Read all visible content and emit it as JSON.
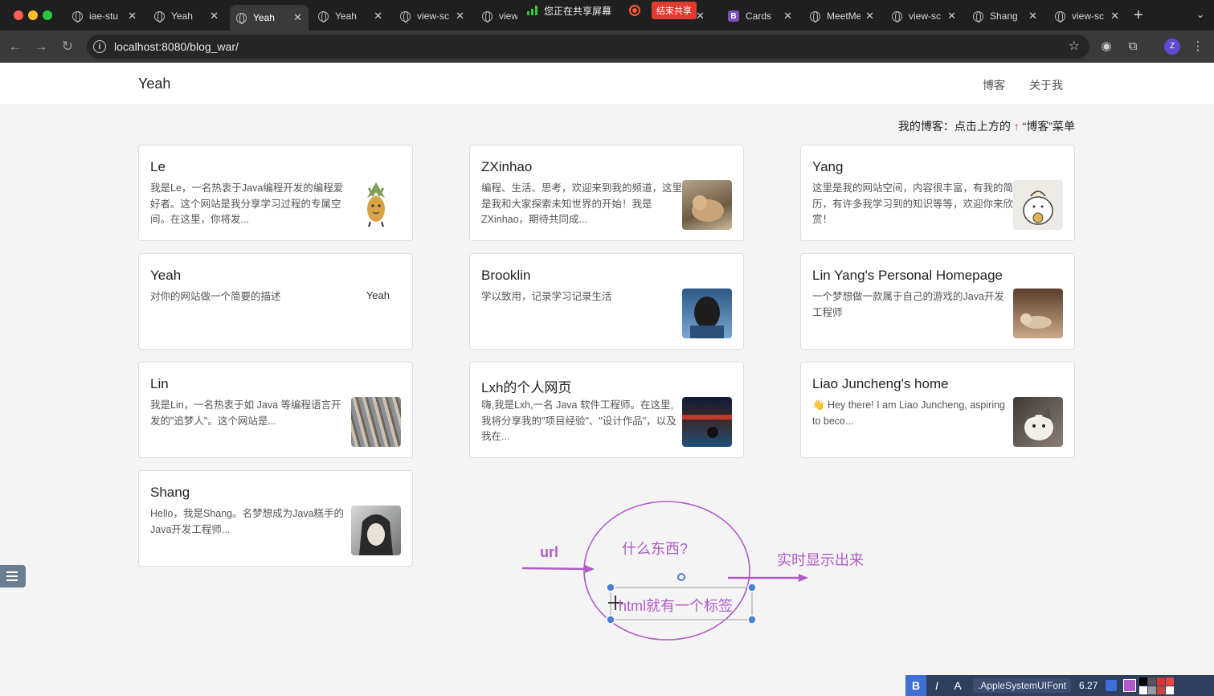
{
  "browser": {
    "tabs": [
      {
        "label": "iae-stu",
        "icon": "globe-icon",
        "active": false
      },
      {
        "label": "Yeah",
        "icon": "globe-icon",
        "active": false
      },
      {
        "label": "Yeah",
        "icon": "globe-icon",
        "active": true
      },
      {
        "label": "Yeah",
        "icon": "globe-icon",
        "active": false
      },
      {
        "label": "view-sc",
        "icon": "globe-icon",
        "active": false
      },
      {
        "label": "view-",
        "icon": "globe-icon",
        "active": false
      },
      {
        "label": "Cards",
        "icon": "bootstrap-icon",
        "active": false
      },
      {
        "label": "MeetMe",
        "icon": "globe-icon",
        "active": false
      },
      {
        "label": "view-sc",
        "icon": "globe-icon",
        "active": false
      },
      {
        "label": "Shang",
        "icon": "globe-icon",
        "active": false
      },
      {
        "label": "view-sc",
        "icon": "globe-icon",
        "active": false
      }
    ],
    "share_banner": {
      "text": "您正在共享屏幕",
      "stop_label": "结束共享"
    },
    "url": "localhost:8080/blog_war/",
    "profile_initial": "Z"
  },
  "site": {
    "brand": "Yeah",
    "nav": [
      {
        "label": "博客"
      },
      {
        "label": "关于我"
      }
    ],
    "hint": {
      "prefix": "我的博客：点击上方的",
      "arrow": "↑",
      "suffix": "“博客”菜单"
    }
  },
  "cards": [
    {
      "title": "Le",
      "desc": "我是Le，一名热衷于Java编程开发的编程爱好者。这个网站是我分享学习过程的专属空间。在这里，你将发...",
      "thumb": "pineapple-avatar"
    },
    {
      "title": "ZXinhao",
      "desc": "编程、生活、思考，欢迎来到我的频道，这里是我和大家探索未知世界的开始！我是ZXinhao，期待共同成...",
      "thumb": "cat-photo"
    },
    {
      "title": "Yang",
      "desc": "这里是我的网站空间，内容很丰富，有我的简历，有许多我学习到的知识等等，欢迎你来欣赏！",
      "thumb": "cartoon-avatar"
    },
    {
      "title": "Yeah",
      "desc": "对你的网站做一个简要的描述",
      "thumb_alt": "Yeah"
    },
    {
      "title": "Brooklin",
      "desc": "学以致用，记录学习记录生活",
      "thumb": "hooded-person-photo"
    },
    {
      "title": "Lin Yang's Personal Homepage",
      "desc": "一个梦想做一款属于自己的游戏的Java开发工程师",
      "thumb": "dog-photo"
    },
    {
      "title": "Lin",
      "desc": "我是Lin，一名热衷于如 Java 等编程语言开发的\"追梦人\"。这个网站是...",
      "thumb": "building-photo"
    },
    {
      "title": "Lxh的个人网页",
      "desc": "嗨,我是Lxh,一名 Java 软件工程师。在这里,我将分享我的\"项目经验\"、\"设计作品\"，以及我在...",
      "thumb": "stadium-photo"
    },
    {
      "title": "Liao Juncheng's home",
      "desc": "👋 Hey there! I am Liao Juncheng, aspiring to beco...",
      "thumb": "cat-face-photo"
    },
    {
      "title": "Shang",
      "desc": "Hello，我是Shang。名梦想成为Java糕手的Java开发工程师...",
      "thumb": "anime-avatar"
    }
  ],
  "annotation": {
    "color": "#b05cc8",
    "input_label": "url",
    "question": "什么东西?",
    "output_label": "实时显示出来",
    "selected_text": "html就有一个标签"
  },
  "format_bar": {
    "bold": "B",
    "italic": "I",
    "font": ".AppleSystemUIFont",
    "size": "6.27"
  }
}
